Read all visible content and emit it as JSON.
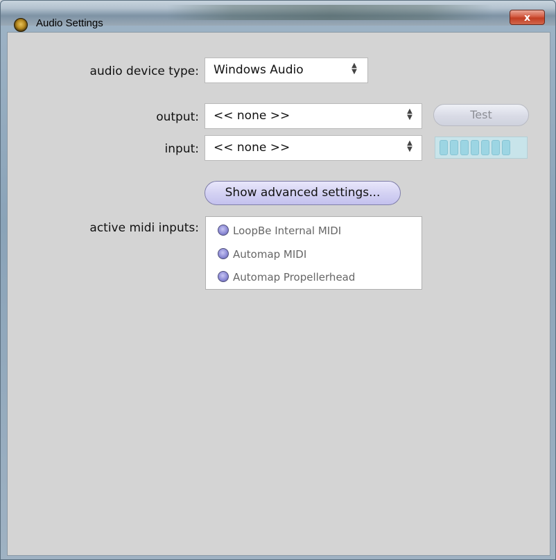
{
  "window": {
    "title": "Audio Settings",
    "close_label": "x"
  },
  "device_type": {
    "label": "audio device type:",
    "value": "Windows Audio"
  },
  "output": {
    "label": "output:",
    "value": "<< none >>"
  },
  "input": {
    "label": "input:",
    "value": "<< none >>"
  },
  "test_button": {
    "label": "Test"
  },
  "level_meter": {
    "segments": 7,
    "level": 0
  },
  "advanced_button": {
    "label": "Show advanced settings..."
  },
  "midi": {
    "label": "active midi inputs:",
    "items": [
      {
        "label": "LoopBe Internal MIDI"
      },
      {
        "label": "Automap MIDI"
      },
      {
        "label": "Automap Propellerhead"
      }
    ]
  },
  "colors": {
    "button_accent": "#c4c1ee",
    "meter": "#9cd5e3",
    "close_red": "#c23e23"
  },
  "icons": [
    "app-icon",
    "close-icon",
    "stepper-icon",
    "radio-icon"
  ]
}
